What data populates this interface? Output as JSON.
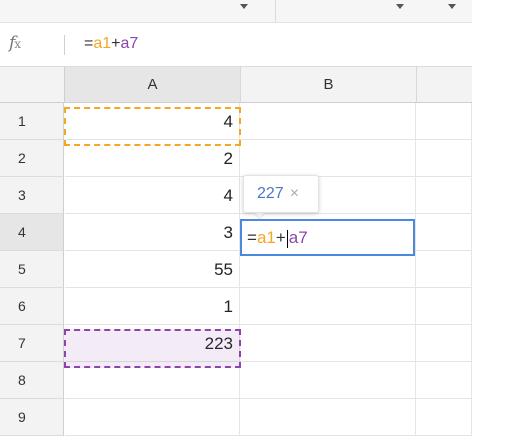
{
  "formula_bar": {
    "fx_label": "f",
    "fx_sub": "x",
    "prefix": "=",
    "ref1": "a1",
    "op": "+",
    "ref2": "a7"
  },
  "columns": [
    "A",
    "B"
  ],
  "rows": [
    {
      "num": "1",
      "a": "4"
    },
    {
      "num": "2",
      "a": "2"
    },
    {
      "num": "3",
      "a": "4"
    },
    {
      "num": "4",
      "a": "3"
    },
    {
      "num": "5",
      "a": "55"
    },
    {
      "num": "6",
      "a": "1"
    },
    {
      "num": "7",
      "a": "223"
    },
    {
      "num": "8",
      "a": ""
    },
    {
      "num": "9",
      "a": ""
    }
  ],
  "editor": {
    "prefix": "=",
    "ref1": "a1",
    "op": "+",
    "ref2": "a7"
  },
  "tooltip": {
    "value": "227",
    "close": "×"
  },
  "colors": {
    "ref1": "#f5a623",
    "ref2": "#8e44ad",
    "editor_border": "#4a89dc",
    "tooltip_value": "#4a78c4"
  }
}
